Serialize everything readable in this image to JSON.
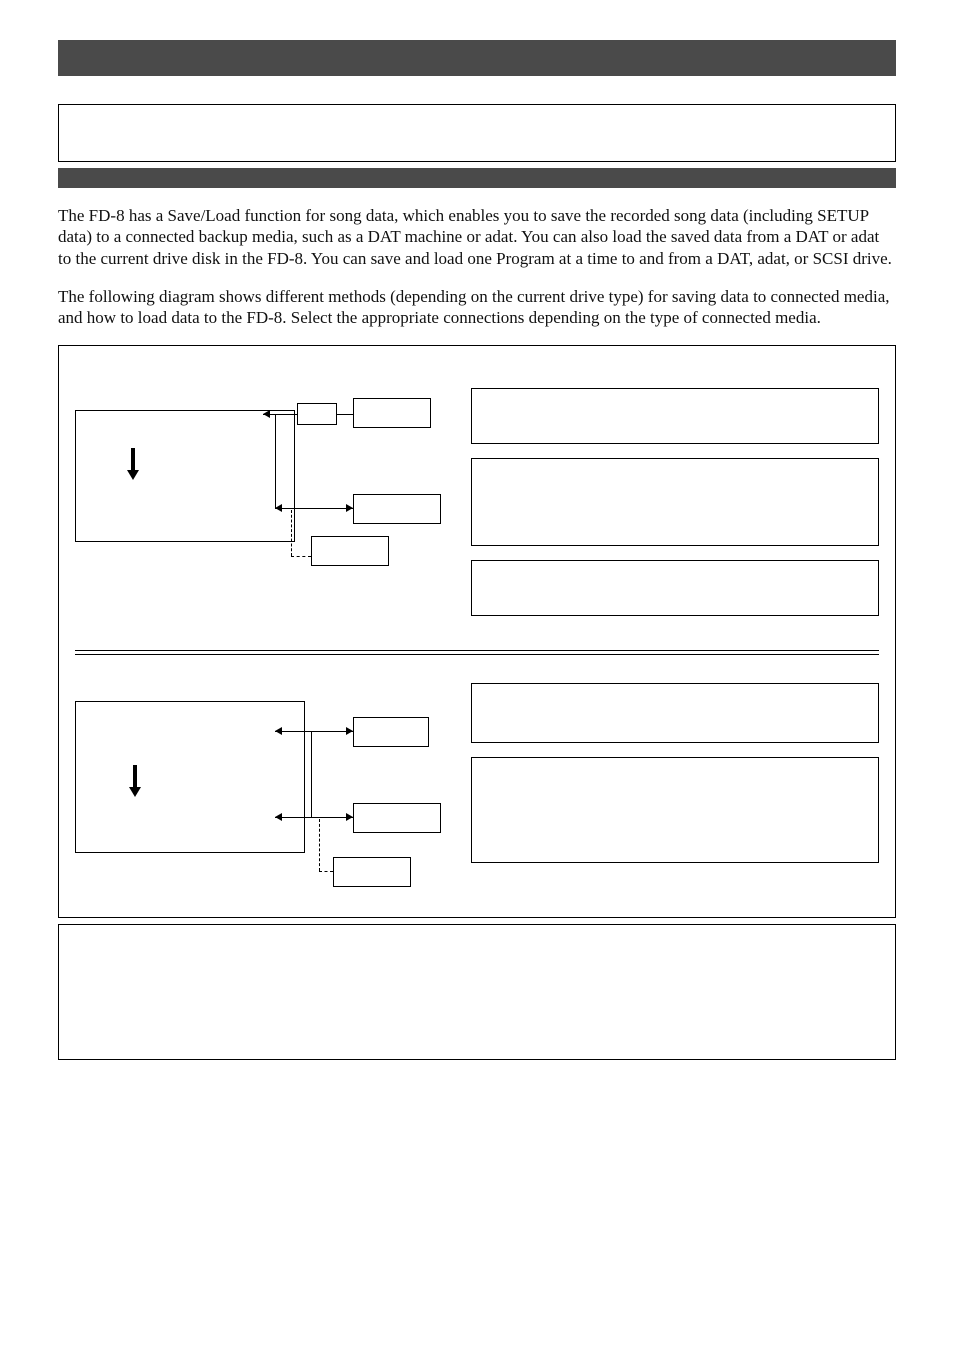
{
  "body_paragraph_1": "The FD-8 has a Save/Load function for song data, which enables you to save the recorded song data (including SETUP data) to a connected backup media, such as a DAT machine or adat.  You can also load the saved data from a DAT or adat to the current drive disk in the FD-8.  You can save and load one Program at a time to and from a DAT, adat, or SCSI drive.",
  "body_paragraph_2": "The following diagram shows different methods (depending on the current drive type) for saving data to connected media, and how to load data to the FD-8.  Select the appropriate connections depending on the type of connected media."
}
